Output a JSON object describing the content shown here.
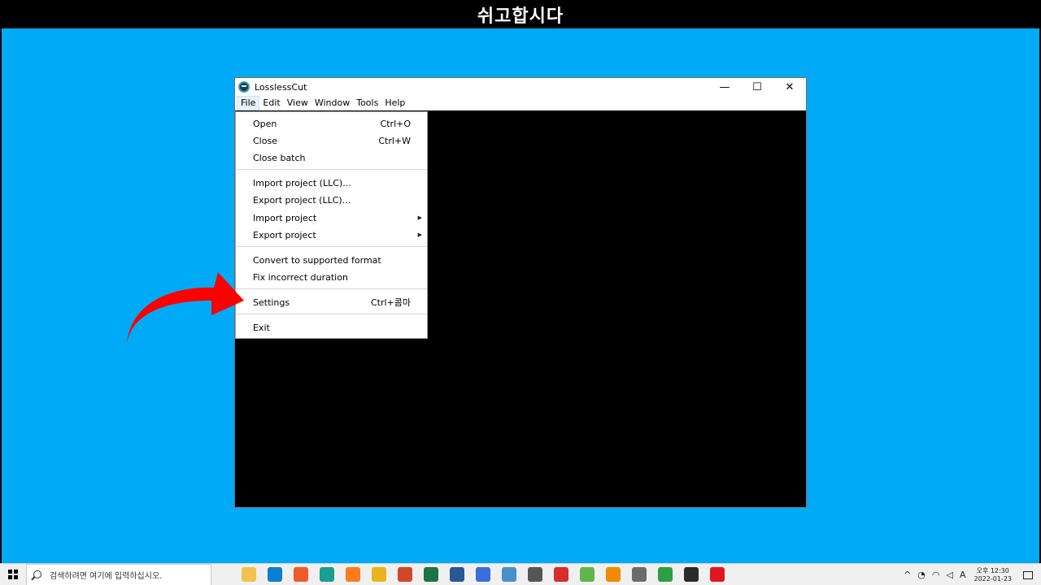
{
  "banner": {
    "text": "쉬고합시다"
  },
  "window": {
    "title": "LosslessCut",
    "controls": {
      "minimize": "—",
      "maximize": "☐",
      "close": "✕"
    }
  },
  "menubar": {
    "items": [
      {
        "label": "File"
      },
      {
        "label": "Edit"
      },
      {
        "label": "View"
      },
      {
        "label": "Window"
      },
      {
        "label": "Tools"
      },
      {
        "label": "Help"
      }
    ]
  },
  "file_menu": {
    "items": [
      {
        "label": "Open",
        "accel": "Ctrl+O"
      },
      {
        "label": "Close",
        "accel": "Ctrl+W"
      },
      {
        "label": "Close batch",
        "accel": ""
      },
      {
        "label": "Import project (LLC)...",
        "accel": ""
      },
      {
        "label": "Export project (LLC)...",
        "accel": ""
      },
      {
        "label": "Import project",
        "accel": "",
        "submenu": true
      },
      {
        "label": "Export project",
        "accel": "",
        "submenu": true
      },
      {
        "label": "Convert to supported format",
        "accel": ""
      },
      {
        "label": "Fix incorrect duration",
        "accel": ""
      },
      {
        "label": "Settings",
        "accel": "Ctrl+콤마"
      },
      {
        "label": "Exit",
        "accel": ""
      }
    ],
    "submenu_glyph": "▶"
  },
  "taskbar": {
    "search_placeholder": "검색하려면 여기에 입력하십시오.",
    "apps": [
      {
        "name": "file-explorer-icon",
        "color": "#f2c14e",
        "glyph": ""
      },
      {
        "name": "edge-icon",
        "color": "#0c7fd1",
        "glyph": ""
      },
      {
        "name": "brave-icon",
        "color": "#f05a28",
        "glyph": ""
      },
      {
        "name": "app-icon",
        "color": "#1a9e8f",
        "glyph": ""
      },
      {
        "name": "firefox-icon",
        "color": "#ff7b1c",
        "glyph": ""
      },
      {
        "name": "chrome-icon",
        "color": "#e8b41f",
        "glyph": ""
      },
      {
        "name": "powerpoint-icon",
        "color": "#d24726",
        "glyph": ""
      },
      {
        "name": "excel-icon",
        "color": "#1f7244",
        "glyph": ""
      },
      {
        "name": "word-icon",
        "color": "#2b5797",
        "glyph": ""
      },
      {
        "name": "hwp-icon",
        "color": "#3b6fd8",
        "glyph": ""
      },
      {
        "name": "remote-icon",
        "color": "#4a90c8",
        "glyph": ""
      },
      {
        "name": "search-tool-icon",
        "color": "#555555",
        "glyph": ""
      },
      {
        "name": "se-icon",
        "color": "#d62d2d",
        "glyph": ""
      },
      {
        "name": "android-icon",
        "color": "#63b54a",
        "glyph": ""
      },
      {
        "name": "vlc-icon",
        "color": "#f08a00",
        "glyph": ""
      },
      {
        "name": "calculator-icon",
        "color": "#6b6b6b",
        "glyph": ""
      },
      {
        "name": "chrome-alt-icon",
        "color": "#2f9e44",
        "glyph": ""
      },
      {
        "name": "sticky-notes-icon",
        "color": "#2b2b2b",
        "glyph": ""
      },
      {
        "name": "opera-icon",
        "color": "#e0171f",
        "glyph": ""
      }
    ],
    "tray": {
      "chevron": "^",
      "ime": "A",
      "time": "오후 12:30",
      "date": "2022-01-23"
    }
  }
}
